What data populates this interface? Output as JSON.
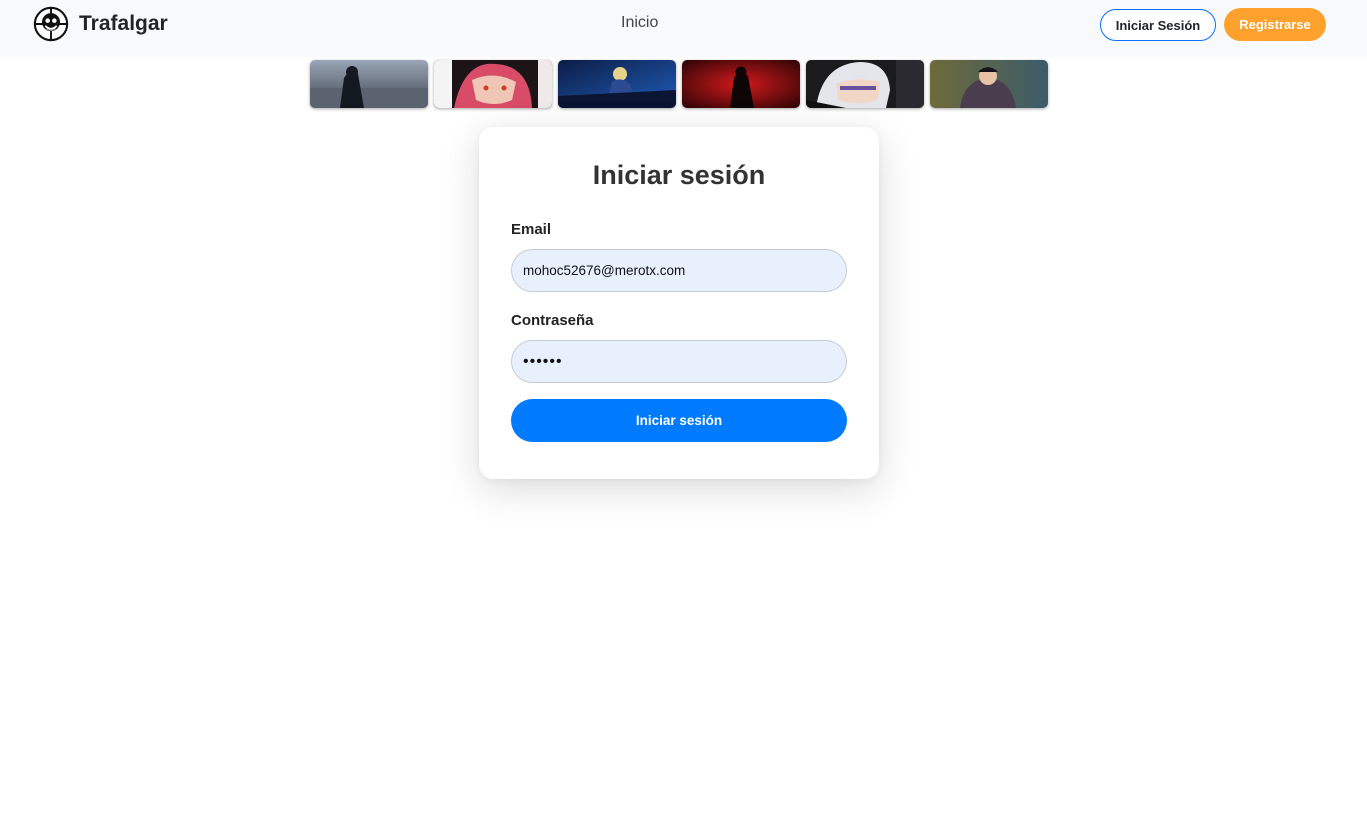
{
  "navbar": {
    "brand_name": "Trafalgar",
    "logo_icon": "jolly-roger-smile-icon",
    "links": [
      {
        "label": "Inicio"
      }
    ],
    "login_label": "Iniciar Sesión",
    "register_label": "Registrarse",
    "colors": {
      "background": "#f8f9fa",
      "login_border": "#0d6efd",
      "register_bg": "#ffa12c"
    }
  },
  "thumbnails": [
    {
      "name": "thumbnail-1"
    },
    {
      "name": "thumbnail-2"
    },
    {
      "name": "thumbnail-3"
    },
    {
      "name": "thumbnail-4"
    },
    {
      "name": "thumbnail-5"
    },
    {
      "name": "thumbnail-6"
    }
  ],
  "login": {
    "title": "Iniciar sesión",
    "email_label": "Email",
    "email_value": "mohoc52676@merotx.com",
    "password_label": "Contraseña",
    "password_value": "••••••",
    "submit_label": "Iniciar sesión",
    "colors": {
      "submit_bg": "#007bff",
      "input_bg": "#e8f0fe"
    }
  }
}
